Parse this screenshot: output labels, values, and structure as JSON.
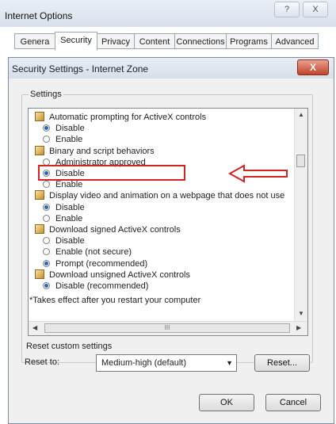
{
  "outer": {
    "title": "Internet Options",
    "help_btn": "?",
    "close_btn": "X",
    "tabs": [
      "Genera",
      "Security",
      "Privacy",
      "Content",
      "Connections",
      "Programs",
      "Advanced"
    ]
  },
  "dialog": {
    "title": "Security Settings - Internet Zone",
    "close_label": "X",
    "group_label": "Settings",
    "items": [
      {
        "kind": "header",
        "text": "Automatic prompting for ActiveX controls"
      },
      {
        "kind": "radio",
        "text": "Disable",
        "checked": true
      },
      {
        "kind": "radio",
        "text": "Enable",
        "checked": false
      },
      {
        "kind": "header",
        "text": "Binary and script behaviors"
      },
      {
        "kind": "radio",
        "text": "Administrator approved",
        "checked": false
      },
      {
        "kind": "radio",
        "text": "Disable",
        "checked": true
      },
      {
        "kind": "radio",
        "text": "Enable",
        "checked": false
      },
      {
        "kind": "header",
        "text": "Display video and animation on a webpage that does not use"
      },
      {
        "kind": "radio",
        "text": "Disable",
        "checked": true
      },
      {
        "kind": "radio",
        "text": "Enable",
        "checked": false
      },
      {
        "kind": "header",
        "text": "Download signed ActiveX controls"
      },
      {
        "kind": "radio",
        "text": "Disable",
        "checked": false
      },
      {
        "kind": "radio",
        "text": "Enable (not secure)",
        "checked": false
      },
      {
        "kind": "radio",
        "text": "Prompt (recommended)",
        "checked": true
      },
      {
        "kind": "header",
        "text": "Download unsigned ActiveX controls"
      },
      {
        "kind": "radio",
        "text": "Disable (recommended)",
        "checked": true
      }
    ],
    "hscroll_thumb": "III",
    "note": "*Takes effect after you restart your computer",
    "reset_group_label": "Reset custom settings",
    "reset_to_label": "Reset to:",
    "reset_value": "Medium-high (default)",
    "reset_button": "Reset...",
    "ok_button": "OK",
    "cancel_button": "Cancel"
  },
  "colors": {
    "annotation": "#d42323"
  }
}
